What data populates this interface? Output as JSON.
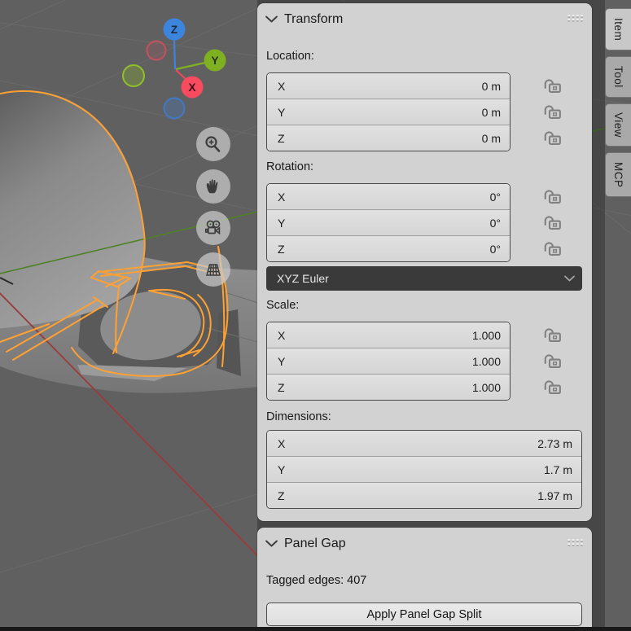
{
  "viewport": {
    "gizmo": {
      "x_label": "X",
      "y_label": "Y",
      "z_label": "Z",
      "x_color": "#f94b60",
      "y_color": "#7fb022",
      "z_color": "#3c85dd"
    },
    "nav_buttons": [
      "zoom-icon",
      "pan-hand-icon",
      "camera-view-icon",
      "toggle-perspective-grid-icon"
    ],
    "colors": {
      "background": "#606060",
      "selection_outline": "#ffa132",
      "x_axis_line": "#9b3a3a",
      "y_axis_line": "#4f8227"
    }
  },
  "sidebar": {
    "tabs": [
      {
        "label": "Item",
        "active": true
      },
      {
        "label": "Tool",
        "active": false
      },
      {
        "label": "View",
        "active": false
      },
      {
        "label": "MCP",
        "active": false
      }
    ],
    "transform_panel": {
      "title": "Transform",
      "location": {
        "label": "Location:",
        "rows": [
          {
            "axis": "X",
            "value": "0 m"
          },
          {
            "axis": "Y",
            "value": "0 m"
          },
          {
            "axis": "Z",
            "value": "0 m"
          }
        ]
      },
      "rotation": {
        "label": "Rotation:",
        "rows": [
          {
            "axis": "X",
            "value": "0°"
          },
          {
            "axis": "Y",
            "value": "0°"
          },
          {
            "axis": "Z",
            "value": "0°"
          }
        ],
        "mode": "XYZ Euler"
      },
      "scale": {
        "label": "Scale:",
        "rows": [
          {
            "axis": "X",
            "value": "1.000"
          },
          {
            "axis": "Y",
            "value": "1.000"
          },
          {
            "axis": "Z",
            "value": "1.000"
          }
        ]
      },
      "dimensions": {
        "label": "Dimensions:",
        "rows": [
          {
            "axis": "X",
            "value": "2.73 m"
          },
          {
            "axis": "Y",
            "value": "1.7 m"
          },
          {
            "axis": "Z",
            "value": "1.97 m"
          }
        ]
      }
    },
    "panel_gap_panel": {
      "title": "Panel Gap",
      "status_text": "Tagged edges: 407",
      "apply_button_label": "Apply Panel Gap Split"
    }
  }
}
